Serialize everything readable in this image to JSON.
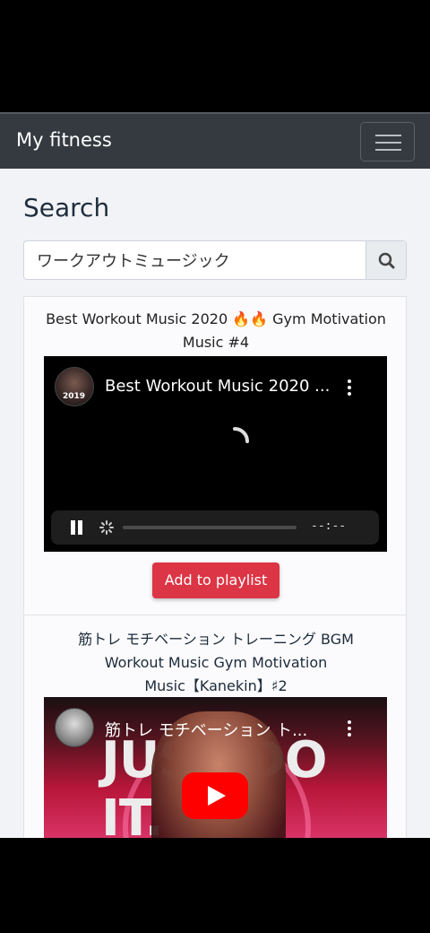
{
  "navbar": {
    "brand": "My fitness",
    "menu_icon": "hamburger-icon"
  },
  "page": {
    "title": "Search"
  },
  "search": {
    "value": "ワークアウトミュージック",
    "button_icon": "search-icon"
  },
  "results": [
    {
      "title_line1": "Best Workout Music 2020 🔥🔥 Gym Motivation",
      "title_line2": "Music #4",
      "player": {
        "heading": "Best Workout Music 2020 ...",
        "avatar_badge": "2019",
        "time": "--:--",
        "state": "buffering"
      },
      "button": "Add to playlist"
    },
    {
      "title_line1": "筋トレ モチベーション トレーニング BGM",
      "title_line2": "Workout Music Gym Motivation",
      "title_line3": "Music【Kanekin】♯2",
      "player": {
        "heading": "筋トレ モチベーション ト...",
        "thumbnail_text": "JUST DO IT."
      }
    }
  ],
  "colors": {
    "navbar": "#343a40",
    "accent": "#dc3545",
    "background": "#f1f3f7"
  }
}
